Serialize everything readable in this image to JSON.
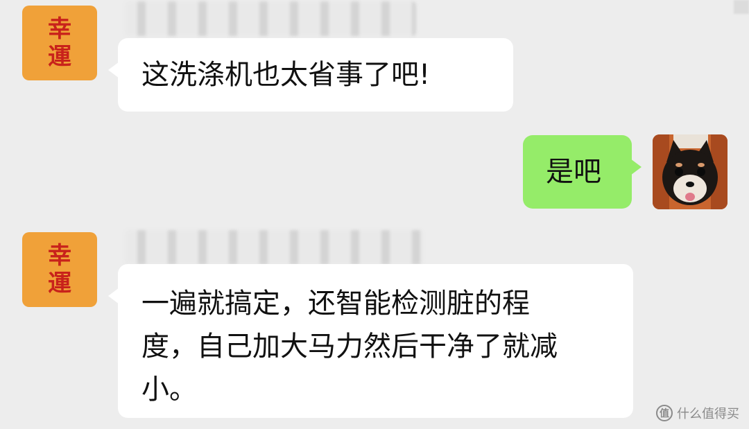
{
  "messages": [
    {
      "side": "left",
      "avatar_chars": [
        "幸",
        "運"
      ],
      "text": "这洗涤机也太省事了吧!"
    },
    {
      "side": "right",
      "text": "是吧"
    },
    {
      "side": "left",
      "avatar_chars": [
        "幸",
        "運"
      ],
      "lines": [
        "一遍就搞定，还智能检测脏的程",
        "度，自己加大马力然后干净了就减",
        "小。"
      ]
    }
  ],
  "watermark": {
    "icon_label": "值",
    "text": "什么值得买"
  },
  "colors": {
    "background": "#ededed",
    "bubble_left": "#ffffff",
    "bubble_right": "#95ec69",
    "avatar_bg": "#f0a139",
    "avatar_text": "#c8221b"
  }
}
